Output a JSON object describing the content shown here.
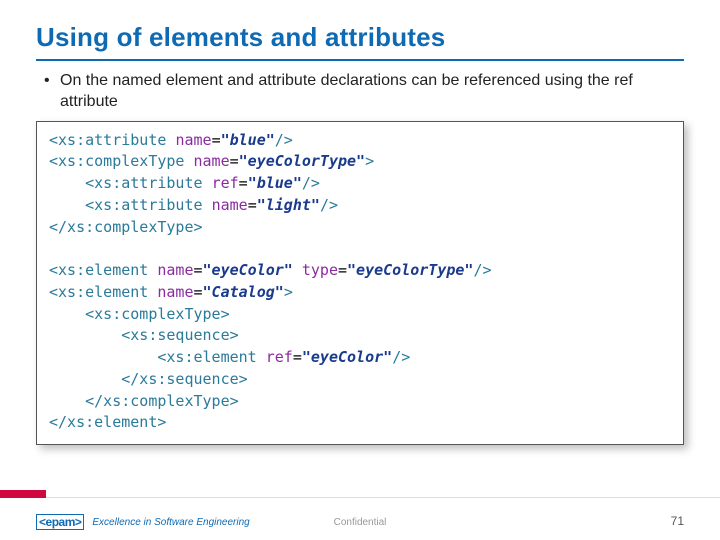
{
  "title": "Using of elements and attributes",
  "bullet": "On the named element and attribute declarations can be referenced using the ref attribute",
  "code": {
    "l1": {
      "t1": "<xs:attribute ",
      "a1": "name",
      "p": "=",
      "v1": "\"blue\"",
      "t2": "/>"
    },
    "l2": {
      "t1": "<xs:complexType ",
      "a1": "name",
      "p": "=",
      "v1": "\"eyeColorType\"",
      "t2": ">"
    },
    "l3": {
      "pad": "    ",
      "t1": "<xs:attribute ",
      "a1": "ref",
      "p": "=",
      "v1": "\"blue\"",
      "t2": "/>"
    },
    "l4": {
      "pad": "    ",
      "t1": "<xs:attribute ",
      "a1": "name",
      "p": "=",
      "v1": "\"light\"",
      "t2": "/>"
    },
    "l5": {
      "t1": "</xs:complexType>"
    },
    "l7": {
      "t1": "<xs:element ",
      "a1": "name",
      "p": "=",
      "v1": "\"eyeColor\" ",
      "a2": "type",
      "v2": "\"eyeColorType\"",
      "t2": "/>"
    },
    "l8": {
      "t1": "<xs:element ",
      "a1": "name",
      "p": "=",
      "v1": "\"Catalog\"",
      "t2": ">"
    },
    "l9": {
      "pad": "    ",
      "t1": "<xs:complexType>"
    },
    "l10": {
      "pad": "        ",
      "t1": "<xs:sequence>"
    },
    "l11": {
      "pad": "            ",
      "t1": "<xs:element ",
      "a1": "ref",
      "p": "=",
      "v1": "\"eyeColor\"",
      "t2": "/>"
    },
    "l12": {
      "pad": "        ",
      "t1": "</xs:sequence>"
    },
    "l13": {
      "pad": "    ",
      "t1": "</xs:complexType>"
    },
    "l14": {
      "t1": "</xs:element>"
    }
  },
  "footer": {
    "logo_text": "epam",
    "tagline": "Excellence in Software Engineering",
    "confidential": "Confidential",
    "page": "71"
  }
}
